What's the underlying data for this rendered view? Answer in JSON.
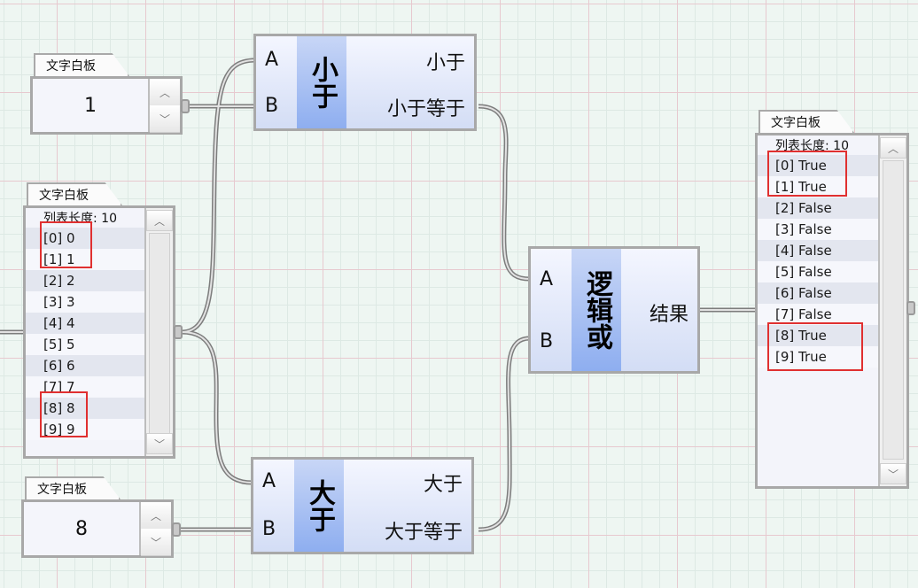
{
  "panel_label": "文字白板",
  "num_box_top": {
    "value": "1"
  },
  "num_box_bottom": {
    "value": "8"
  },
  "input_list": {
    "header": "列表长度: 10",
    "items": [
      "[0] 0",
      "[1] 1",
      "[2] 2",
      "[3] 3",
      "[4] 4",
      "[5] 5",
      "[6] 6",
      "[7] 7",
      "[8] 8",
      "[9] 9"
    ]
  },
  "output_list": {
    "header": "列表长度: 10",
    "items": [
      "[0] True",
      "[1] True",
      "[2] False",
      "[3] False",
      "[4] False",
      "[5] False",
      "[6] False",
      "[7] False",
      "[8] True",
      "[9] True"
    ]
  },
  "less_than": {
    "title": "小于",
    "port_a": "A",
    "port_b": "B",
    "out1": "小于",
    "out2": "小于等于"
  },
  "greater_than": {
    "title": "大于",
    "port_a": "A",
    "port_b": "B",
    "out1": "大于",
    "out2": "大于等于"
  },
  "logic_or": {
    "title": "逻辑或",
    "port_a": "A",
    "port_b": "B",
    "out": "结果"
  },
  "colors": {
    "highlight": "#e03030",
    "component_band": "#8eaef0",
    "grid_major": "#e7c9cf"
  }
}
